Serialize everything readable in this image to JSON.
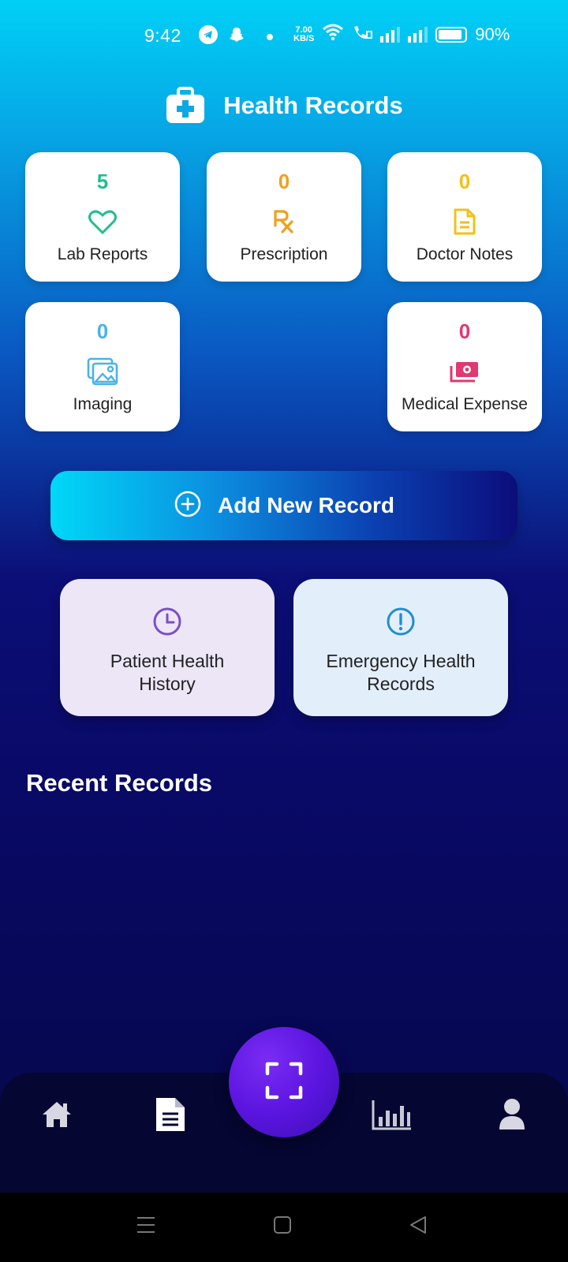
{
  "status_bar": {
    "time": "9:42",
    "speed_value": "7.00",
    "speed_unit": "KB/S",
    "battery": "90%"
  },
  "header": {
    "title": "Health Records",
    "icon": "first-aid-kit-icon"
  },
  "stats": [
    {
      "label": "Lab Reports",
      "count": "5",
      "icon": "heart-icon",
      "color": "#1fbf8f"
    },
    {
      "label": "Prescription",
      "count": "0",
      "icon": "rx-icon",
      "color": "#f0a020"
    },
    {
      "label": "Doctor Notes",
      "count": "0",
      "icon": "document-icon",
      "color": "#f2c01a"
    },
    {
      "label": "Imaging",
      "count": "0",
      "icon": "image-icon",
      "color": "#4ab3e6"
    },
    {
      "label": "Medical Expense",
      "count": "0",
      "icon": "money-icon",
      "color": "#e0386f"
    }
  ],
  "add_button": {
    "label": "Add New Record",
    "icon": "plus-circle-icon"
  },
  "actions": [
    {
      "label_line1": "Patient Health",
      "label_line2": "History",
      "icon": "clock-icon",
      "color": "#7b4fc4",
      "bg": "#ece6f7"
    },
    {
      "label_line1": "Emergency Health",
      "label_line2": "Records",
      "icon": "alert-circle-icon",
      "color": "#1e8fd0",
      "bg": "#e3eefb"
    }
  ],
  "recent": {
    "title": "Recent Records"
  },
  "bottom_nav": {
    "items": [
      "home-icon",
      "document-icon",
      "scan-icon",
      "chart-icon",
      "profile-icon"
    ]
  }
}
